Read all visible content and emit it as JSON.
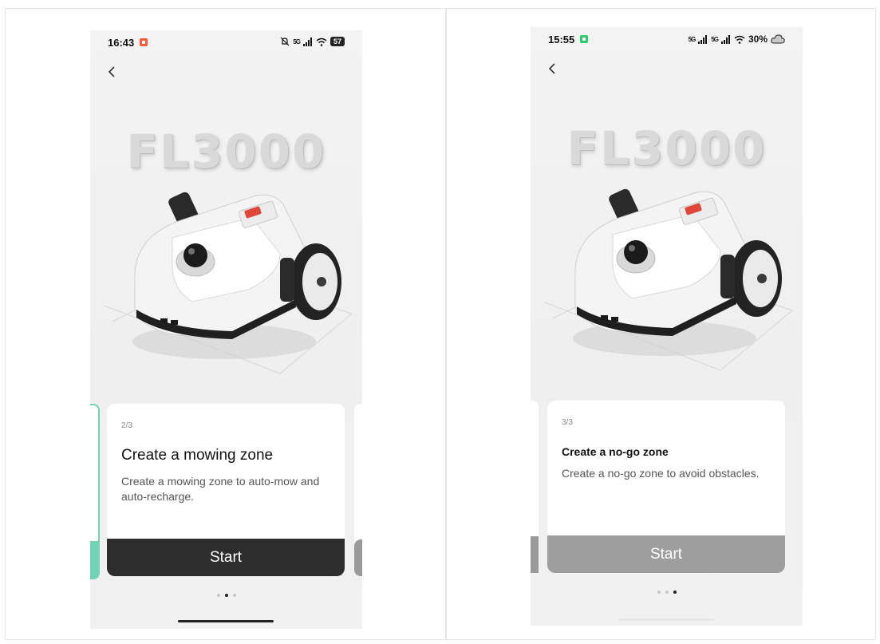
{
  "left_screen": {
    "status": {
      "time": "16:43",
      "app_icon_color": "#f25c3c",
      "signal": "5G",
      "battery": "57"
    },
    "model_name": "FL3000",
    "card": {
      "step": "2/3",
      "title": "Create a mowing zone",
      "description": "Create a mowing zone to auto-mow and auto-recharge.",
      "button_label": "Start"
    },
    "pagination": {
      "total": 3,
      "active": 2
    },
    "accent_color": "#6fd3b5"
  },
  "right_screen": {
    "status": {
      "time": "15:55",
      "app_icon_color": "#2ecc71",
      "signal": "5G",
      "battery": "30%"
    },
    "model_name": "FL3000",
    "card": {
      "step": "3/3",
      "title": "Create a no-go zone",
      "description": "Create a no-go zone to avoid obstacles.",
      "button_label": "Start"
    },
    "pagination": {
      "total": 3,
      "active": 3
    }
  },
  "icons": {
    "back": "chevron-left-icon",
    "mute": "bell-off-icon",
    "wifi": "wifi-icon",
    "cloud": "cloud-icon"
  }
}
